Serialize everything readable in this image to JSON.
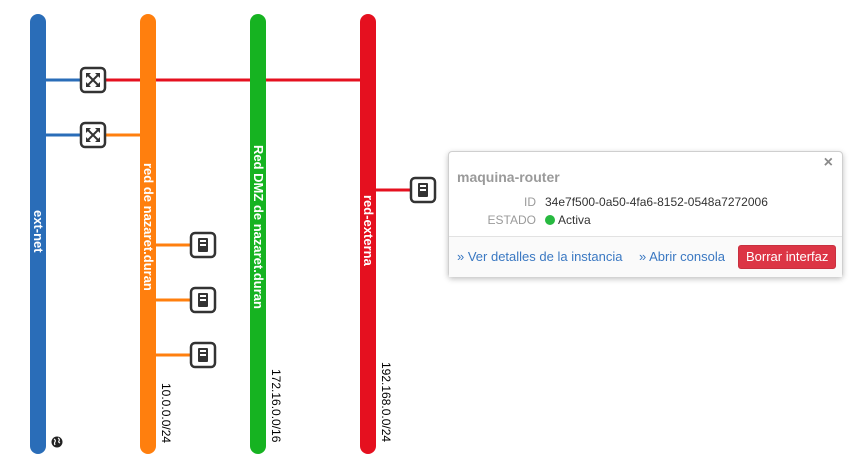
{
  "networks": [
    {
      "id": "ext-net",
      "name": "ext-net",
      "color": "#2a6db8",
      "cidr": ""
    },
    {
      "id": "nazaret",
      "name": "red de nazaret.duran",
      "color": "#ff7f0e",
      "cidr": "10.0.0.0/24"
    },
    {
      "id": "dmz",
      "name": "Red DMZ de nazaret.duran",
      "color": "#16b321",
      "cidr": "172.16.0.0/16"
    },
    {
      "id": "externa",
      "name": "red-externa",
      "color": "#e5101f",
      "cidr": "192.168.0.0/24"
    }
  ],
  "devices": {
    "routers": [
      "router-1",
      "router-2"
    ],
    "instances": [
      "instance-1",
      "instance-2",
      "instance-3",
      "maquina-router"
    ]
  },
  "popup": {
    "title": "maquina-router",
    "id_label": "ID",
    "id_value": "34e7f500-0a50-4fa6-8152-0548a7272006",
    "status_label": "ESTADO",
    "status_value": "Activa",
    "status_color": "#27b940",
    "close": "×",
    "details_link": "» Ver detalles de la instancia",
    "console_link": "» Abrir consola",
    "delete_button": "Borrar interfaz"
  }
}
